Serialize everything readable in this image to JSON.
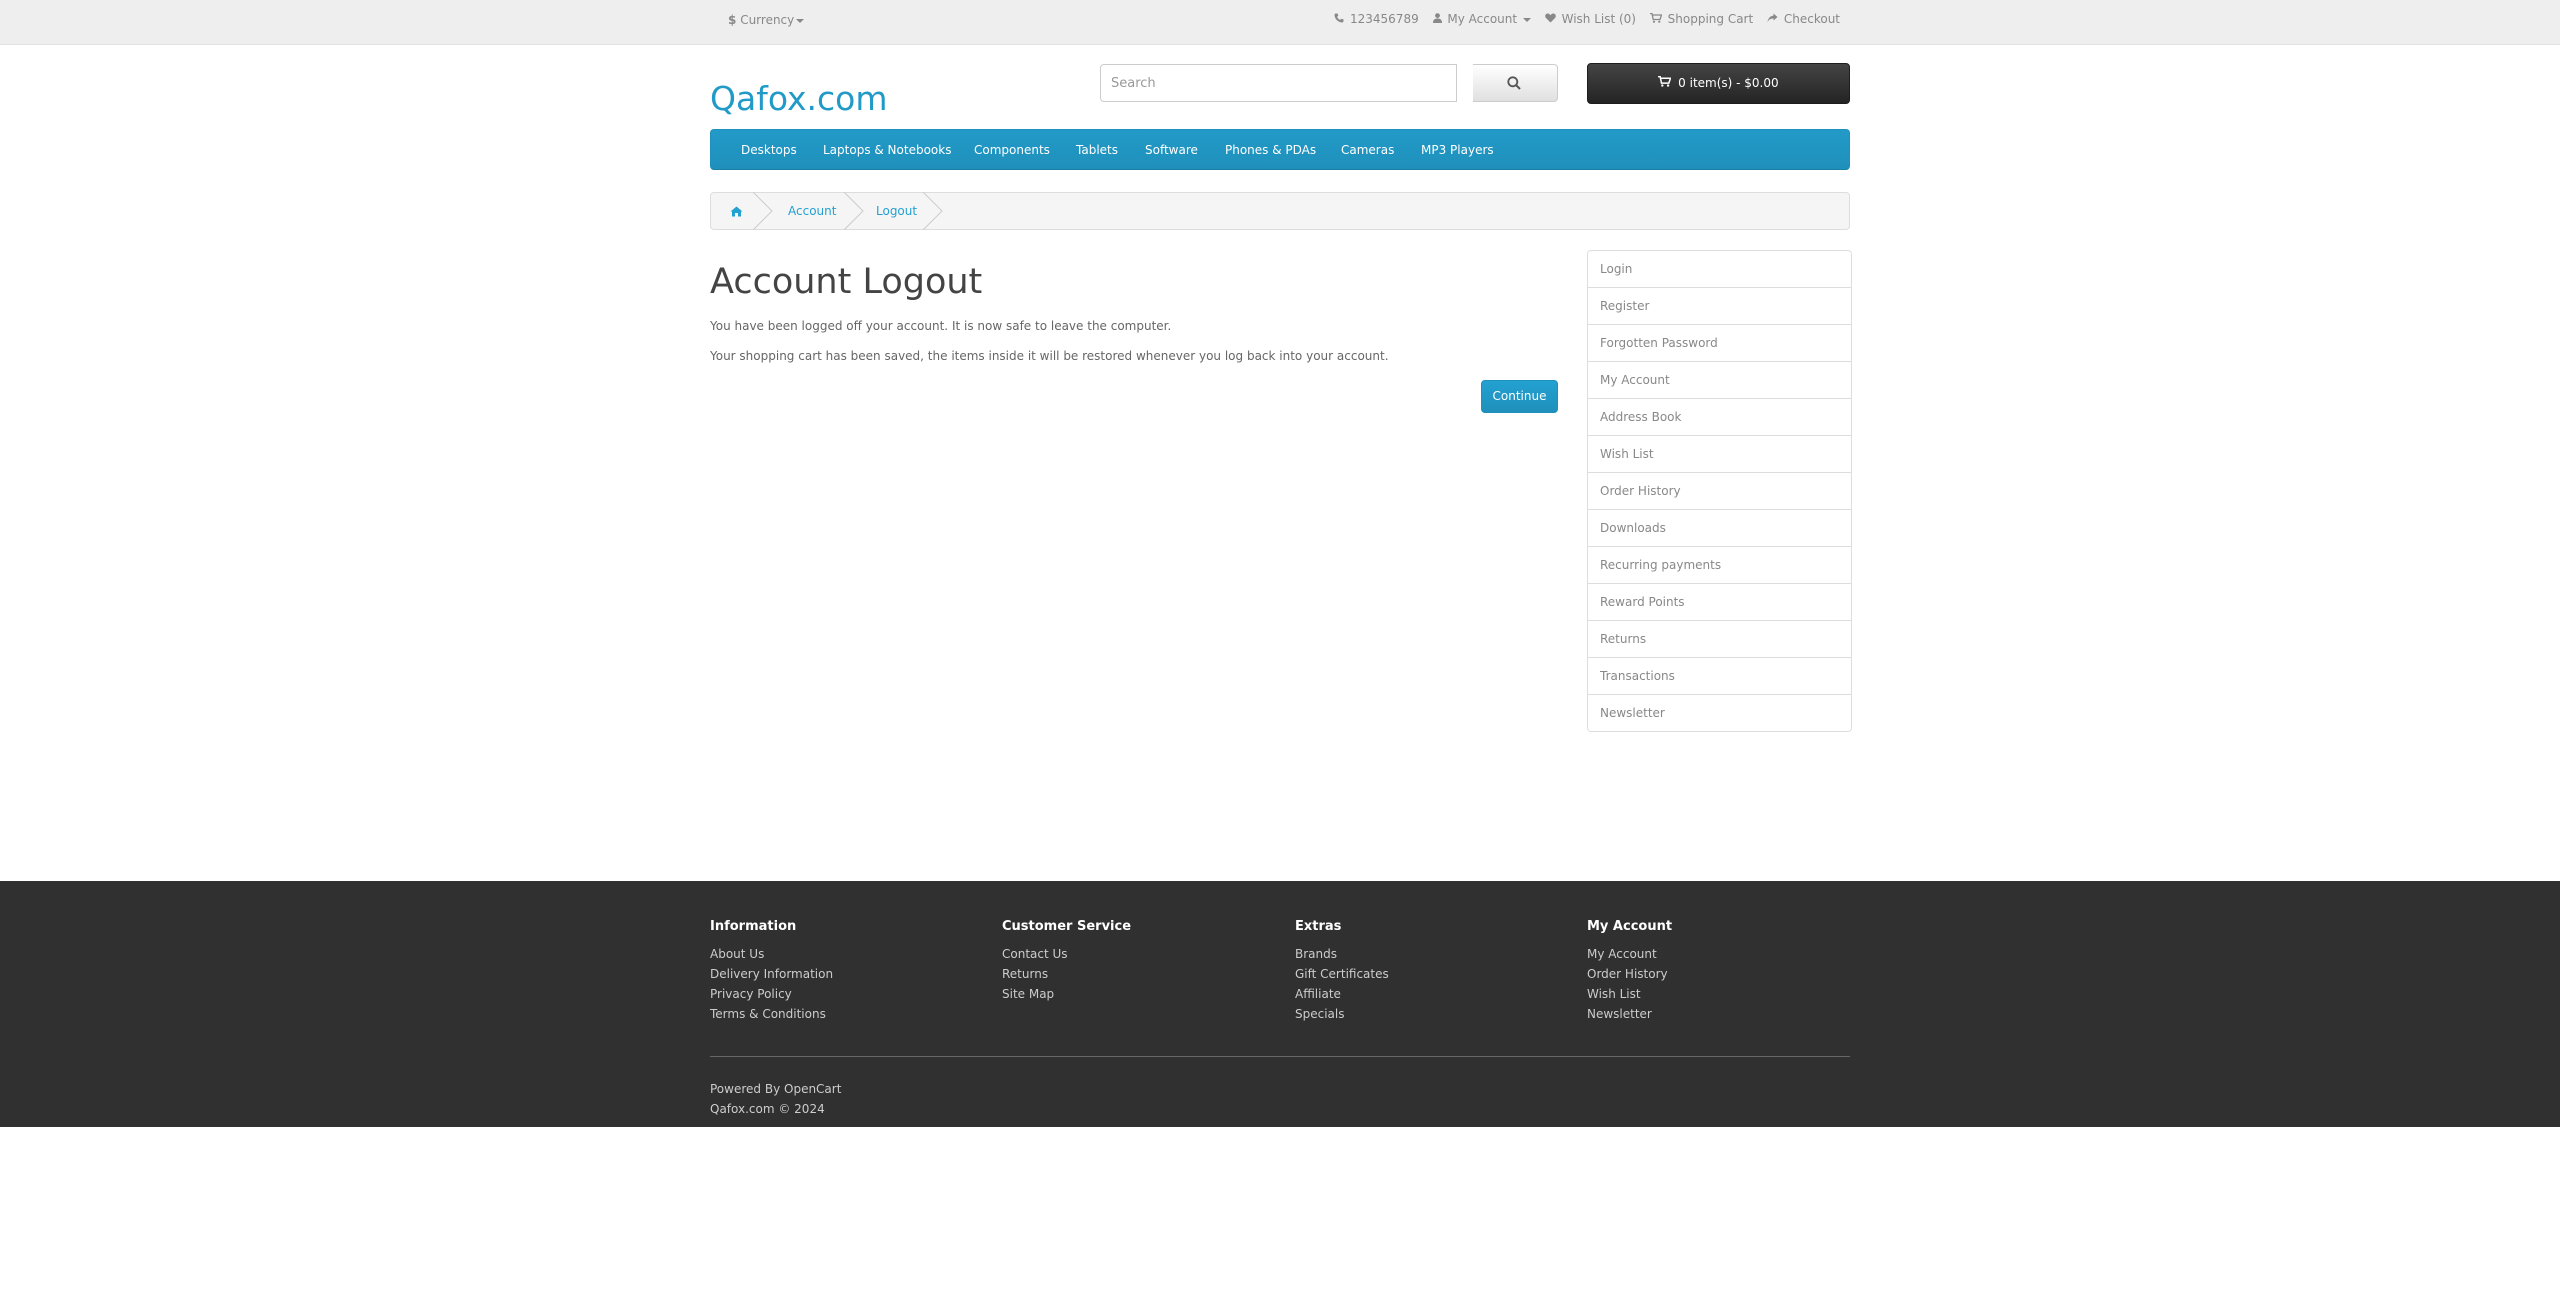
{
  "top_bar": {
    "currency_symbol": "$",
    "currency_label": "Currency",
    "phone": "123456789",
    "my_account": "My Account",
    "wish_list": "Wish List (0)",
    "shopping_cart": "Shopping Cart",
    "checkout": "Checkout"
  },
  "header": {
    "logo": "Qafox.com",
    "search_placeholder": "Search",
    "cart_label": "0 item(s) - $0.00"
  },
  "menu": {
    "items": [
      "Desktops",
      "Laptops & Notebooks",
      "Components",
      "Tablets",
      "Software",
      "Phones & PDAs",
      "Cameras",
      "MP3 Players"
    ]
  },
  "breadcrumb": {
    "items": [
      "Account",
      "Logout"
    ]
  },
  "main": {
    "title": "Account Logout",
    "para1": "You have been logged off your account. It is now safe to leave the computer.",
    "para2": "Your shopping cart has been saved, the items inside it will be restored whenever you log back into your account.",
    "continue_label": "Continue"
  },
  "sidebar": {
    "items": [
      "Login",
      "Register",
      "Forgotten Password",
      "My Account",
      "Address Book",
      "Wish List",
      "Order History",
      "Downloads",
      "Recurring payments",
      "Reward Points",
      "Returns",
      "Transactions",
      "Newsletter"
    ]
  },
  "footer": {
    "columns": [
      {
        "heading": "Information",
        "links": [
          "About Us",
          "Delivery Information",
          "Privacy Policy",
          "Terms & Conditions"
        ]
      },
      {
        "heading": "Customer Service",
        "links": [
          "Contact Us",
          "Returns",
          "Site Map"
        ]
      },
      {
        "heading": "Extras",
        "links": [
          "Brands",
          "Gift Certificates",
          "Affiliate",
          "Specials"
        ]
      },
      {
        "heading": "My Account",
        "links": [
          "My Account",
          "Order History",
          "Wish List",
          "Newsletter"
        ]
      }
    ],
    "powered_by": "Powered By",
    "opencart": "OpenCart",
    "copyright": "Qafox.com © 2024"
  },
  "colors": {
    "accent": "#229ac8",
    "menu_bg": "#229ac8",
    "cart_bg": "#303030",
    "footer_bg": "#303030"
  }
}
